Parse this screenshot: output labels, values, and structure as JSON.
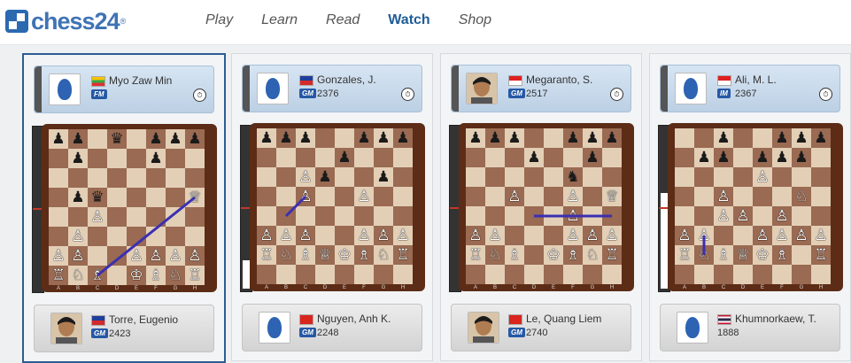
{
  "header": {
    "logo_text": "chess24",
    "logo_tm": "®",
    "nav": [
      "Play",
      "Learn",
      "Read",
      "Watch",
      "Shop"
    ],
    "active_nav": "Watch"
  },
  "colors": {
    "brand": "#2b69b0",
    "badge": "#2658a5",
    "arrow": "#3b2fb2"
  },
  "games": [
    {
      "selected": true,
      "top": {
        "name": "Myo Zaw Min",
        "title": "FM",
        "rating": "",
        "flag": "flag-myanmar",
        "avatar": "silhouette",
        "clock_icon": "clock-icon"
      },
      "bottom": {
        "name": "Torre, Eugenio",
        "title": "GM",
        "rating": "2423",
        "flag": "flag-philippines",
        "avatar": "photo"
      },
      "eval_white_fraction": 0.0,
      "board": [
        "♜♞♝_♛♝♞♜",
        "♟♟___♟♟♟",
        "_♟___♟__",
        "__________",
        "_♟♛_____♕",
        "__♙_____",
        "_♙______",
        "♙♙___♙♙♙",
        "♖♘♗_♔♗♘♖"
      ],
      "arrow": {
        "from": [
          2,
          7
        ],
        "to": [
          7,
          3
        ]
      }
    },
    {
      "selected": false,
      "top": {
        "name": "Gonzales, J.",
        "title": "GM",
        "rating": "2376",
        "flag": "flag-philippines",
        "avatar": "silhouette",
        "clock_icon": "clock-icon"
      },
      "bottom": {
        "name": "Nguyen, Anh K.",
        "title": "GM",
        "rating": "2248",
        "flag": "flag-vietnam",
        "avatar": "silhouette"
      },
      "eval_white_fraction": 0.18,
      "arrow": {
        "from": [
          1,
          4
        ],
        "to": [
          2,
          3
        ]
      }
    },
    {
      "selected": false,
      "top": {
        "name": "Megaranto, S.",
        "title": "GM",
        "rating": "2517",
        "flag": "flag-indonesia",
        "avatar": "photo",
        "clock_icon": "clock-icon"
      },
      "bottom": {
        "name": "Le, Quang Liem",
        "title": "GM",
        "rating": "2740",
        "flag": "flag-vietnam",
        "avatar": "photo"
      },
      "eval_white_fraction": 0.0,
      "arrow": {
        "from": [
          3,
          4
        ],
        "to": [
          7,
          4
        ]
      }
    },
    {
      "selected": false,
      "top": {
        "name": "Ali, M. L.",
        "title": "IM",
        "rating": "2367",
        "flag": "flag-indonesia",
        "avatar": "silhouette",
        "clock_icon": "clock-icon"
      },
      "bottom": {
        "name": "Khumnorkaew, T.",
        "title": "",
        "rating": "1888",
        "flag": "flag-thailand",
        "avatar": "silhouette"
      },
      "eval_white_fraction": 0.6,
      "arrow": {
        "from": [
          1,
          6
        ],
        "to": [
          1,
          5
        ]
      }
    }
  ],
  "boards": [
    [
      "♜♞♝ ♛♝♞♜",
      "♟♟ ♛ ♟♟♟",
      " ♟   ♟  ",
      "        ",
      " ♟♛    ♕",
      "  ♙     ",
      " ♙      ",
      "♙♙  ♙♙♙♙",
      "♖♘♗ ♔♗♘♖"
    ],
    [
      "♜ ♞♝♛♚♝♜",
      "♟♟♟  ♟♟♟",
      "    ♟   ",
      "  ♙♟  ♟ ",
      "  ♙  ♙  ",
      "        ",
      "♙♙♙  ♙♙♙",
      "♖♘♗♕♔♗♘♖"
    ],
    [
      "♜♞♝♛♚♝ ♜",
      "♟♟♟  ♟♟♟",
      "   ♟  ♟ ",
      "     ♞  ",
      "  ♙  ♙ ♕",
      "     ♙  ",
      "♙♙   ♙♙♙",
      "♖♘♗ ♔♗♘♖"
    ],
    [
      "♜♞♝♛♚♝♞♜",
      "  ♟  ♟♟♟",
      " ♟♟ ♟♟♟ ",
      "    ♙   ",
      "  ♙   ♘ ",
      "  ♙♙ ♙  ",
      "♙♙  ♙♙♙♙",
      "♖♘♗♕♔♗ ♖"
    ]
  ],
  "files": [
    "A",
    "B",
    "C",
    "D",
    "E",
    "F",
    "G",
    "H"
  ]
}
